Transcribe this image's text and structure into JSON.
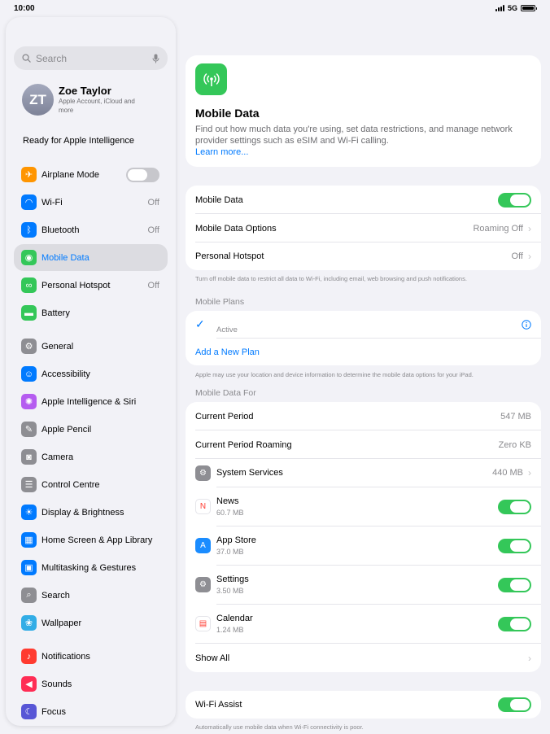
{
  "status": {
    "time": "10:00",
    "network": "5G"
  },
  "sidebar": {
    "search_placeholder": "Search",
    "profile": {
      "initials": "ZT",
      "name": "Zoe Taylor",
      "subtitle": "Apple Account, iCloud and more"
    },
    "ready": "Ready for Apple Intelligence",
    "items": [
      {
        "label": "Airplane Mode",
        "icon": "airplane-icon",
        "color": "#ff9500",
        "toggle": "off"
      },
      {
        "label": "Wi-Fi",
        "icon": "wifi-icon",
        "color": "#007aff",
        "value": "Off"
      },
      {
        "label": "Bluetooth",
        "icon": "bluetooth-icon",
        "color": "#007aff",
        "value": "Off"
      },
      {
        "label": "Mobile Data",
        "icon": "antenna-icon",
        "color": "#34c759",
        "selected": true
      },
      {
        "label": "Personal Hotspot",
        "icon": "link-icon",
        "color": "#34c759",
        "value": "Off"
      },
      {
        "label": "Battery",
        "icon": "battery-icon",
        "color": "#34c759"
      },
      {
        "label": "General",
        "icon": "gear-icon",
        "color": "#8e8e93"
      },
      {
        "label": "Accessibility",
        "icon": "accessibility-icon",
        "color": "#007aff"
      },
      {
        "label": "Apple Intelligence & Siri",
        "icon": "siri-icon",
        "color": "#b55cf0"
      },
      {
        "label": "Apple Pencil",
        "icon": "pencil-icon",
        "color": "#8e8e93"
      },
      {
        "label": "Camera",
        "icon": "camera-icon",
        "color": "#8e8e93"
      },
      {
        "label": "Control Centre",
        "icon": "control-centre-icon",
        "color": "#8e8e93"
      },
      {
        "label": "Display & Brightness",
        "icon": "sun-icon",
        "color": "#007aff"
      },
      {
        "label": "Home Screen & App Library",
        "icon": "home-screen-icon",
        "color": "#007aff"
      },
      {
        "label": "Multitasking & Gestures",
        "icon": "multitasking-icon",
        "color": "#007aff"
      },
      {
        "label": "Search",
        "icon": "search-icon",
        "color": "#8e8e93"
      },
      {
        "label": "Wallpaper",
        "icon": "flower-icon",
        "color": "#32ade6"
      },
      {
        "label": "Notifications",
        "icon": "bell-icon",
        "color": "#ff3b30"
      },
      {
        "label": "Sounds",
        "icon": "speaker-icon",
        "color": "#ff2d55"
      },
      {
        "label": "Focus",
        "icon": "moon-icon",
        "color": "#5856d6"
      }
    ]
  },
  "header": {
    "title": "Mobile Data",
    "description": "Find out how much data you're using, set data restrictions, and manage network provider settings such as eSIM and Wi-Fi calling.",
    "link": "Learn more..."
  },
  "settings": {
    "mobile_data": "Mobile Data",
    "options_label": "Mobile Data Options",
    "options_value": "Roaming Off",
    "hotspot_label": "Personal Hotspot",
    "hotspot_value": "Off",
    "footnote": "Turn off mobile data to restrict all data to Wi-Fi, including email, web browsing and push notifications."
  },
  "plans": {
    "title": "Mobile Plans",
    "active": "Active",
    "add": "Add a New Plan",
    "footnote": "Apple may use your location and device information to determine the mobile data options for your iPad."
  },
  "usage": {
    "title": "Mobile Data For",
    "current_period_label": "Current Period",
    "current_period_value": "547 MB",
    "roaming_label": "Current Period Roaming",
    "roaming_value": "Zero KB",
    "system_label": "System Services",
    "system_value": "440 MB",
    "apps": [
      {
        "name": "News",
        "size": "60.7 MB",
        "icon": "news-icon",
        "color": "#ffffff"
      },
      {
        "name": "App Store",
        "size": "37.0 MB",
        "icon": "app-store-icon",
        "color": "#1a8cff"
      },
      {
        "name": "Settings",
        "size": "3.50 MB",
        "icon": "gear-icon",
        "color": "#8e8e93"
      },
      {
        "name": "Calendar",
        "size": "1.24 MB",
        "icon": "calendar-icon",
        "color": "#ffffff"
      }
    ],
    "show_all": "Show All"
  },
  "wifi_assist": {
    "label": "Wi-Fi Assist",
    "footnote": "Automatically use mobile data when Wi-Fi connectivity is poor."
  }
}
